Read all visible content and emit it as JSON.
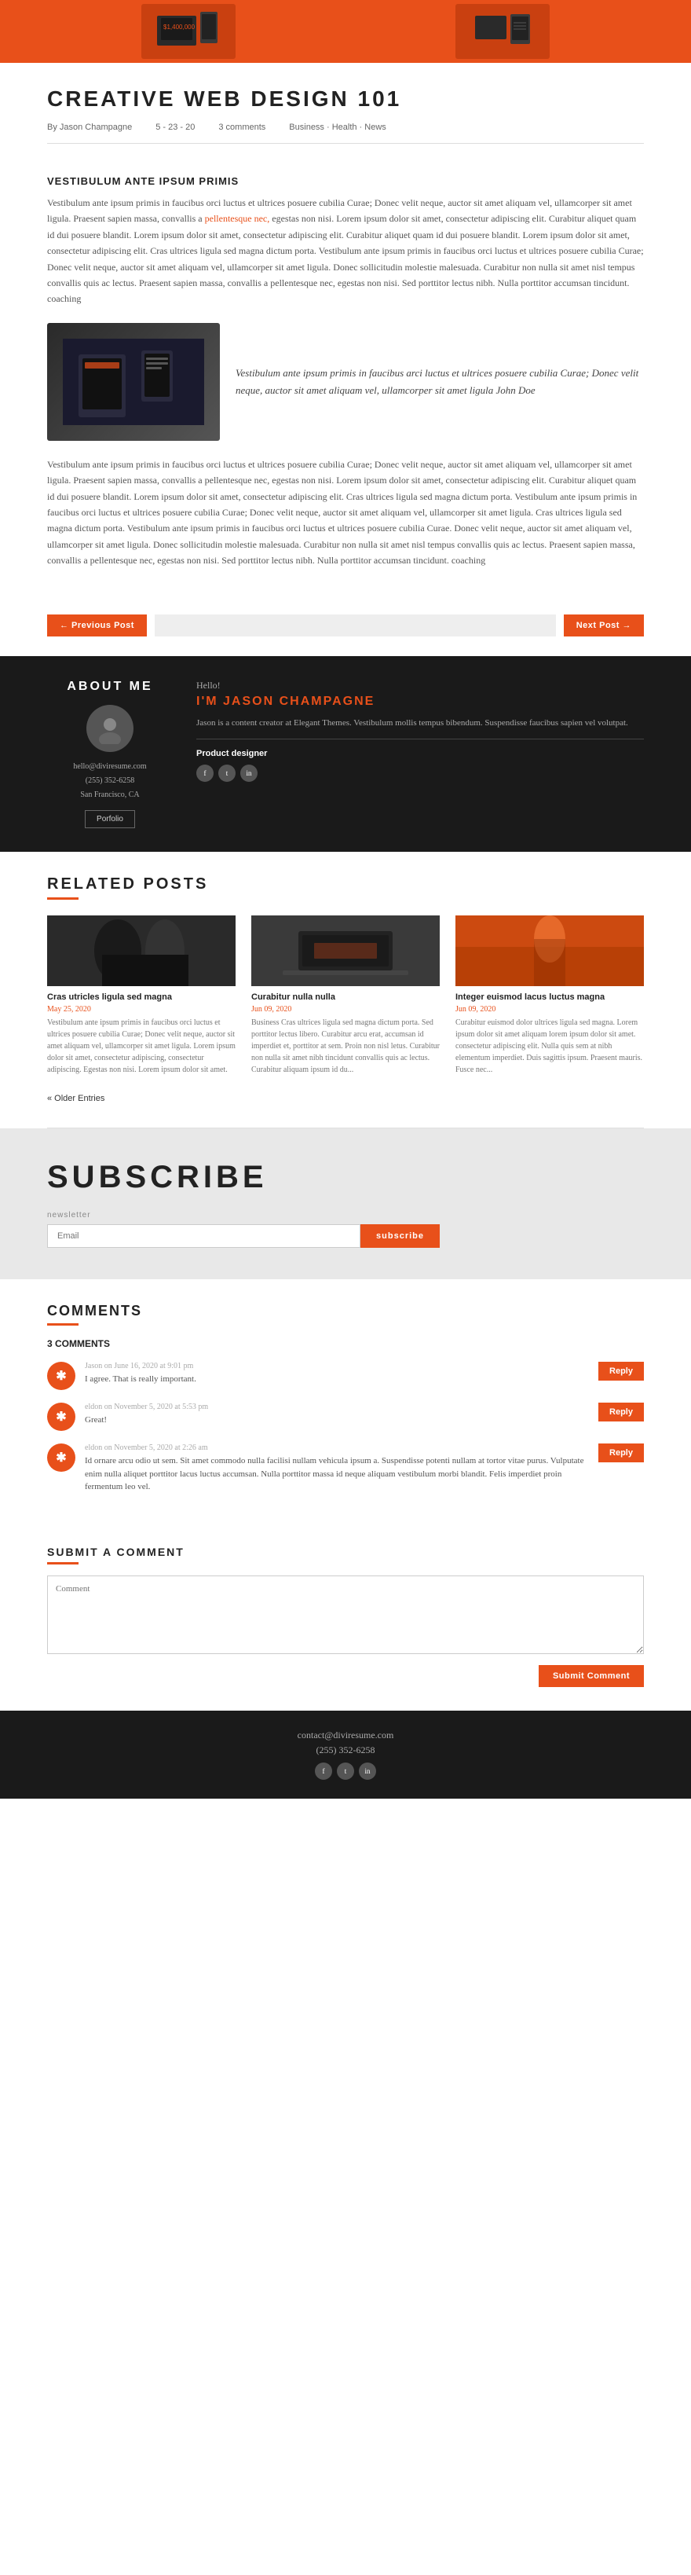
{
  "hero": {
    "alt": "Hero banner with phone mockups"
  },
  "post": {
    "title": "CREATIVE WEB DESIGN 101",
    "meta": {
      "author": "By Jason Champagne",
      "date": "5 - 23 - 20",
      "comments": "3 comments",
      "categories": "Business · Health · News"
    },
    "section_heading": "VESTIBULUM ANTE IPSUM PRIMIS",
    "body1": "Vestibulum ante ipsum primis in faucibus orci luctus et ultrices posuere cubilia Curae; Donec velit neque, auctor sit amet aliquam vel, ullamcorper sit amet ligula. Praesent sapien massa, convallis a pellentesque nec, egestas non nisi. Lorem ipsum dolor sit amet, consectetur adipiscing elit. Curabitur aliquet quam id dui posuere blandit. Lorem ipsum dolor sit amet, consectetur adipiscing elit. Curabitur aliquet quam id dui posuere blandit. Lorem ipsum dolor sit amet, consectetur adipiscing elit. Cras ultrices ligula sed magna dictum porta. Vestibulum ante ipsum primis in faucibus orci luctus et ultrices posuere cubilia Curae; Donec velit neque, auctor sit amet aliquam vel, ullamcorper sit amet ligula. Donec sollicitudin molestie malesuada. Curabitur non nulla sit amet nisl tempus convallis quis ac lectus. Praesent sapien massa, convallis a pellentesque nec, egestas non nisi. Sed porttitor lectus nibh. Nulla porttitor accumsan tincidunt. coaching",
    "pull_quote": "Vestibulum ante ipsum primis in faucibus arci luctus et ultrices posuere cubilia Curae; Donec velit neque, auctor sit amet aliquam vel, ullamcorper sit amet ligula\nJohn Doe",
    "body2": "Vestibulum ante ipsum primis in faucibus orci luctus et ultrices posuere cubilia Curae; Donec velit neque, auctor sit amet aliquam vel, ullamcorper sit amet ligula. Praesent sapien massa, convallis a pellentesque nec, egestas non nisi. Lorem ipsum dolor sit amet, consectetur adipiscing elit. Curabitur aliquet quam id dui posuere blandit. Lorem ipsum dolor sit amet, consectetur adipiscing elit. Cras ultrices ligula sed magna dictum porta. Vestibulum ante ipsum primis in faucibus orci luctus et ultrices posuere cubilia Curae; Donec velit neque, auctor sit amet aliquam vel, ullamcorper sit amet ligula. Cras ultrices ligula sed magna dictum porta. Vestibulum ante ipsum primis in faucibus orci luctus et ultrices posuere cubilia Curae. Donec velit neque, auctor sit amet aliquam vel, ullamcorper sit amet ligula. Donec sollicitudin molestie malesuada. Curabitur non nulla sit amet nisl tempus convallis quis ac lectus. Praesent sapien massa, convallis a pellentesque nec, egestas non nisi. Sed porttitor lectus nibh. Nulla porttitor accumsan tincidunt. coaching",
    "body1_link": "pellentesque nec,"
  },
  "nav": {
    "prev_label": "← Previous Post",
    "next_label": "Next Post →"
  },
  "about": {
    "heading": "ABOUT ME",
    "hello": "Hello!",
    "name": "I'M JASON CHAMPAGNE",
    "bio": "Jason is a content creator at Elegant Themes. Vestibulum mollis tempus bibendum. Suspendisse faucibus sapien vel volutpat.",
    "role": "Product designer",
    "email": "hello@diviresume.com",
    "phone": "(255) 352-6258",
    "location": "San Francisco, CA",
    "portfolio_label": "Porfolio",
    "social": [
      "f",
      "t",
      "in"
    ]
  },
  "related": {
    "heading": "RELATED POSTS",
    "older_entries": "« Older Entries",
    "posts": [
      {
        "title": "Cras utricles ligula sed magna",
        "date": "May 25, 2020",
        "text": "Vestibulum ante ipsum primis in faucibus orci luctus et ultrices posuere cubilia Curae; Donec velit neque, auctor sit amet aliquam vel, ullamcorper sit amet ligula. Lorem ipsum dolor sit amet, consectetur adipiscing, consectetur adipiscing. Egestas non nisi. Lorem ipsum dolor sit amet."
      },
      {
        "title": "Curabitur nulla nulla",
        "date": "Jun 09, 2020",
        "text": "Business Cras ultrices ligula sed magna dictum porta. Sed porttitor lectus libero. Curabitur arcu erat, accumsan id imperdiet et, porttitor at sem. Proin non nisl letus. Curabitur non nulla sit amet nibh tincidunt convallis quis ac lectus. Curabitur aliquam ipsum id du..."
      },
      {
        "title": "Integer euismod lacus luctus magna",
        "date": "Jun 09, 2020",
        "text": "Curabitur euismod dolor ultrices ligula sed magna. Lorem ipsum dolor sit amet aliquam lorem ipsum dolor sit amet. consectetur adipiscing elit. Nulla quis sem at nibh elementum imperdiet. Duis sagittis ipsum. Praesent mauris. Fusce nec..."
      }
    ]
  },
  "subscribe": {
    "heading": "SUBSCRIBE",
    "label": "newsletter",
    "input_placeholder": "Email",
    "button_label": "subscribe"
  },
  "comments": {
    "heading": "COMMENTS",
    "count_label": "3 COMMENTS",
    "items": [
      {
        "author": "Jason on June 16, 2020 at 9:01 pm",
        "text": "I agree. That is really important.",
        "reply_label": "Reply"
      },
      {
        "author": "eldon on November 5, 2020 at 5:53 pm",
        "text": "Great!",
        "reply_label": "Reply"
      },
      {
        "author": "eldon on November 5, 2020 at 2:26 am",
        "text": "Id ornare arcu odio ut sem. Sit amet commodo nulla facilisi nullam vehicula ipsum a. Suspendisse potenti nullam at tortor vitae purus. Vulputate enim nulla aliquet porttitor lacus luctus accumsan. Nulla porttitor massa id neque aliquam vestibulum morbi blandit. Felis imperdiet proin fermentum leo vel.",
        "reply_label": "Reply"
      }
    ]
  },
  "submit_comment": {
    "heading": "SUBMIT A COMMENT",
    "placeholder": "Comment",
    "button_label": "Submit Comment"
  },
  "footer": {
    "email": "contact@diviresume.com",
    "phone": "(255) 352-6258",
    "social": [
      "f",
      "t",
      "in"
    ]
  }
}
